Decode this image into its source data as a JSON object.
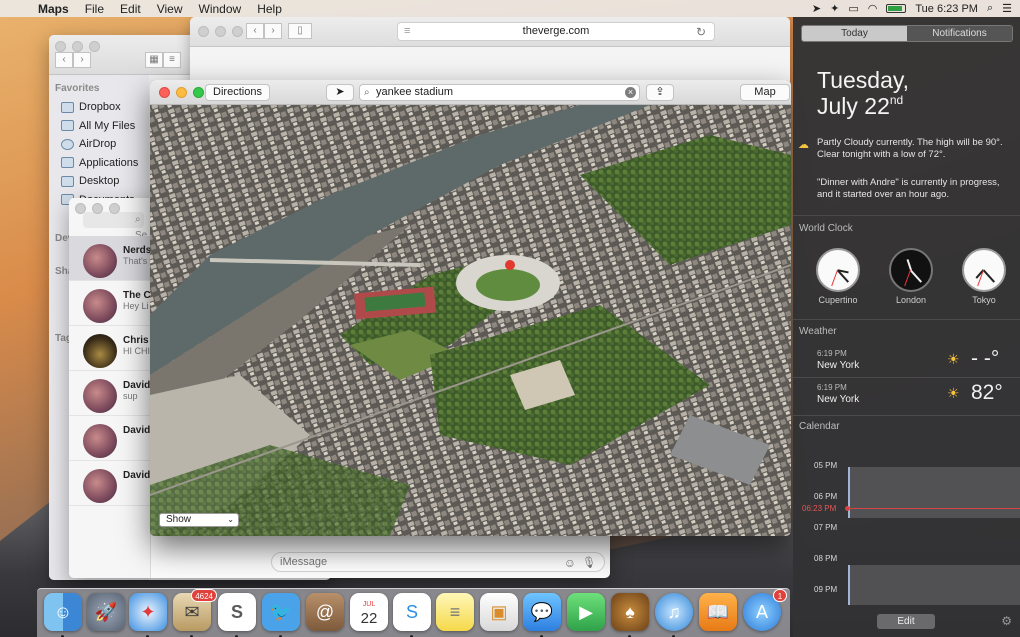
{
  "menubar": {
    "app": "Maps",
    "menus": [
      "File",
      "Edit",
      "View",
      "Window",
      "Help"
    ],
    "clock": "Tue 6:23 PM"
  },
  "safari": {
    "url": "theverge.com"
  },
  "finder": {
    "favorites_header": "Favorites",
    "favorites": [
      "Dropbox",
      "All My Files",
      "AirDrop",
      "Applications",
      "Desktop",
      "Documents"
    ],
    "devices_header": "Devi",
    "shared_header": "Sha",
    "tags_header": "Tag",
    "tag_colors": [
      "#e0413a",
      "#f0a030",
      "#e8d23a",
      "#58b848",
      "#3b7fe0",
      "#a25bd0",
      "#999999"
    ]
  },
  "messages": {
    "search_placeholder": "Se",
    "conversations": [
      {
        "name": "Nerds",
        "preview": "That's"
      },
      {
        "name": "The Co",
        "preview": "Hey Li probab"
      },
      {
        "name": "Chris J",
        "preview": "HI CHI"
      },
      {
        "name": "David",
        "preview": "sup"
      },
      {
        "name": "David",
        "preview": ""
      },
      {
        "name": "David",
        "preview": ""
      }
    ],
    "input_placeholder": "iMessage"
  },
  "maps": {
    "directions_label": "Directions",
    "search_value": "yankee stadium",
    "map_mode_label": "Map",
    "show_label": "Show"
  },
  "notification_center": {
    "tab_today": "Today",
    "tab_notifications": "Notifications",
    "weekday": "Tuesday,",
    "date": "July 22",
    "date_suffix": "nd",
    "weather_summary": "Partly Cloudy currently. The high will be 90°. Clear tonight with a low of 72°.",
    "calendar_summary": "\"Dinner with Andre\" is currently in progress, and it started over an hour ago.",
    "world_clock_header": "World Clock",
    "clocks": [
      {
        "city": "Cupertino",
        "hour": 3,
        "minute": 23
      },
      {
        "city": "London",
        "hour": 11,
        "minute": 23
      },
      {
        "city": "Tokyo",
        "hour": 7,
        "minute": 23
      }
    ],
    "weather_header": "Weather",
    "weather": [
      {
        "time": "6:19 PM",
        "city": "New York",
        "temp": "- -°"
      },
      {
        "time": "6:19 PM",
        "city": "New York",
        "temp": "82°"
      }
    ],
    "calendar_header": "Calendar",
    "calendar_hours": [
      "05 PM",
      "06 PM",
      "06:23 PM",
      "07 PM",
      "08 PM",
      "09 PM"
    ],
    "edit_label": "Edit"
  },
  "dock": {
    "mail_badge": "4624",
    "calendar_month": "JUL",
    "calendar_day": "22",
    "appstore_badge": "1"
  }
}
